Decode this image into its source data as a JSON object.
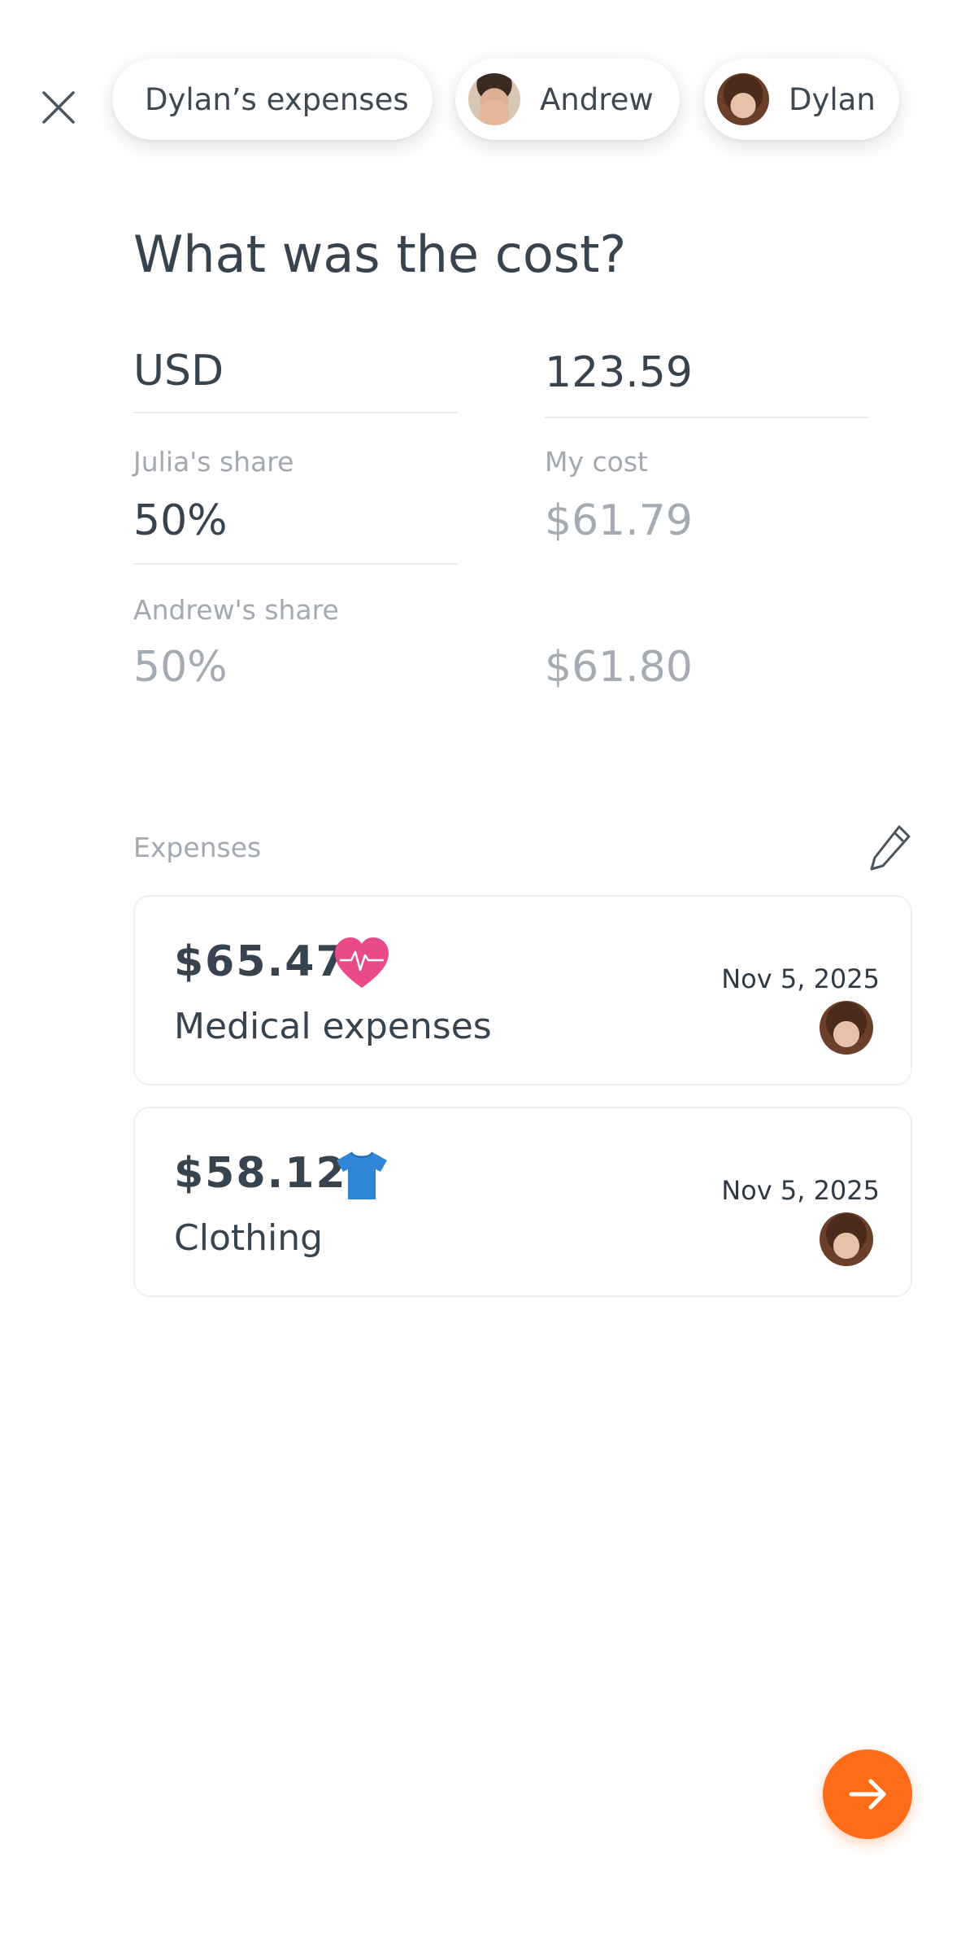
{
  "header": {
    "title_pill": "Dylan’s expenses",
    "participants": [
      {
        "name": "Andrew"
      },
      {
        "name": "Dylan"
      }
    ]
  },
  "question": "What was the cost?",
  "currency": "USD",
  "amount": "123.59",
  "shares": {
    "julia": {
      "label": "Julia's share",
      "percent": "50%"
    },
    "my_cost": {
      "label": "My cost",
      "value": "$61.79"
    },
    "andrew": {
      "label": "Andrew's share",
      "percent": "50%",
      "value": "$61.80"
    }
  },
  "expenses": {
    "label": "Expenses",
    "items": [
      {
        "amount": "$65.47",
        "description": "Medical expenses",
        "date": "Nov 5, 2025",
        "icon": "heart-pulse-icon",
        "icon_color": "#e84a8a"
      },
      {
        "amount": "$58.12",
        "description": "Clothing",
        "date": "Nov 5, 2025",
        "icon": "tshirt-icon",
        "icon_color": "#2f86d6"
      }
    ]
  },
  "colors": {
    "accent": "#fe6c1a",
    "text": "#37434e",
    "muted": "#a4abb2"
  }
}
